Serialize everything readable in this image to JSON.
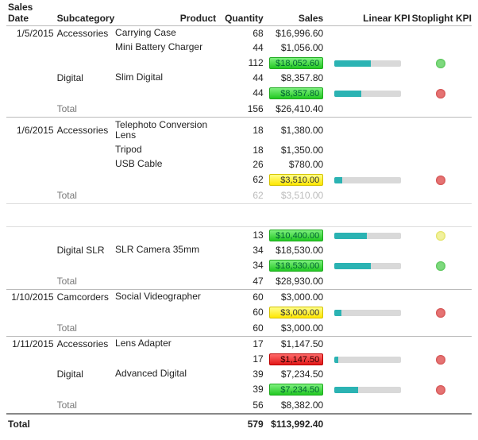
{
  "columns": {
    "date": "Sales Date",
    "subcat": "Subcategory",
    "product": "Product",
    "qty": "Quantity",
    "sales": "Sales",
    "linear": "Linear KPI",
    "stop": "Stoplight KPI"
  },
  "grand": {
    "label": "Total",
    "qty": "579",
    "sales": "$113,992.40"
  },
  "g": [
    {
      "date": "1/5/2015",
      "subs": [
        {
          "name": "Accessories",
          "rows": [
            {
              "product": "Carrying Case",
              "qty": "68",
              "sales": "$16,996.60"
            },
            {
              "product": "Mini Battery Charger",
              "qty": "44",
              "sales": "$1,056.00"
            }
          ],
          "subtotal": {
            "qty": "112",
            "sales": "$18,052.60",
            "kpi": "green",
            "linear": 55,
            "dot": "green"
          }
        },
        {
          "name": "Digital",
          "rows": [
            {
              "product": "Slim Digital",
              "qty": "44",
              "sales": "$8,357.80"
            }
          ],
          "subtotal": {
            "qty": "44",
            "sales": "$8,357.80",
            "kpi": "green",
            "linear": 40,
            "dot": "red"
          }
        }
      ],
      "total": {
        "label": "Total",
        "qty": "156",
        "sales": "$26,410.40"
      }
    },
    {
      "date": "1/6/2015",
      "subs": [
        {
          "name": "Accessories",
          "rows": [
            {
              "product": "Telephoto Conversion Lens",
              "qty": "18",
              "sales": "$1,380.00"
            },
            {
              "product": "Tripod",
              "qty": "18",
              "sales": "$1,350.00"
            },
            {
              "product": "USB Cable",
              "qty": "26",
              "sales": "$780.00"
            }
          ],
          "subtotal": {
            "qty": "62",
            "sales": "$3,510.00",
            "kpi": "yellow",
            "linear": 12,
            "dot": "red"
          }
        }
      ],
      "total_dim": {
        "label": "Total",
        "qty": "62",
        "sales": "$3,510.00"
      },
      "orphan": {
        "qty": "13",
        "sales": "$10,400.00",
        "kpi": "green",
        "linear": 48,
        "dot": "yellow"
      },
      "subs2": [
        {
          "name": "Digital SLR",
          "rows": [
            {
              "product": "SLR Camera 35mm",
              "qty": "34",
              "sales": "$18,530.00"
            }
          ],
          "subtotal": {
            "qty": "34",
            "sales": "$18,530.00",
            "kpi": "green",
            "linear": 55,
            "dot": "green"
          }
        }
      ],
      "total2": {
        "label": "Total",
        "qty": "47",
        "sales": "$28,930.00"
      }
    },
    {
      "date": "1/10/2015",
      "subs": [
        {
          "name": "Camcorders",
          "rows": [
            {
              "product": "Social Videographer",
              "qty": "60",
              "sales": "$3,000.00"
            }
          ],
          "subtotal": {
            "qty": "60",
            "sales": "$3,000.00",
            "kpi": "yellow",
            "linear": 10,
            "dot": "red"
          }
        }
      ],
      "total": {
        "label": "Total",
        "qty": "60",
        "sales": "$3,000.00"
      }
    },
    {
      "date": "1/11/2015",
      "subs": [
        {
          "name": "Accessories",
          "rows": [
            {
              "product": "Lens Adapter",
              "qty": "17",
              "sales": "$1,147.50"
            }
          ],
          "subtotal": {
            "qty": "17",
            "sales": "$1,147.50",
            "kpi": "red",
            "linear": 6,
            "dot": "red"
          }
        },
        {
          "name": "Digital",
          "rows": [
            {
              "product": "Advanced Digital",
              "qty": "39",
              "sales": "$7,234.50"
            }
          ],
          "subtotal": {
            "qty": "39",
            "sales": "$7,234.50",
            "kpi": "green",
            "linear": 35,
            "dot": "red"
          }
        }
      ],
      "total": {
        "label": "Total",
        "qty": "56",
        "sales": "$8,382.00"
      }
    }
  ]
}
